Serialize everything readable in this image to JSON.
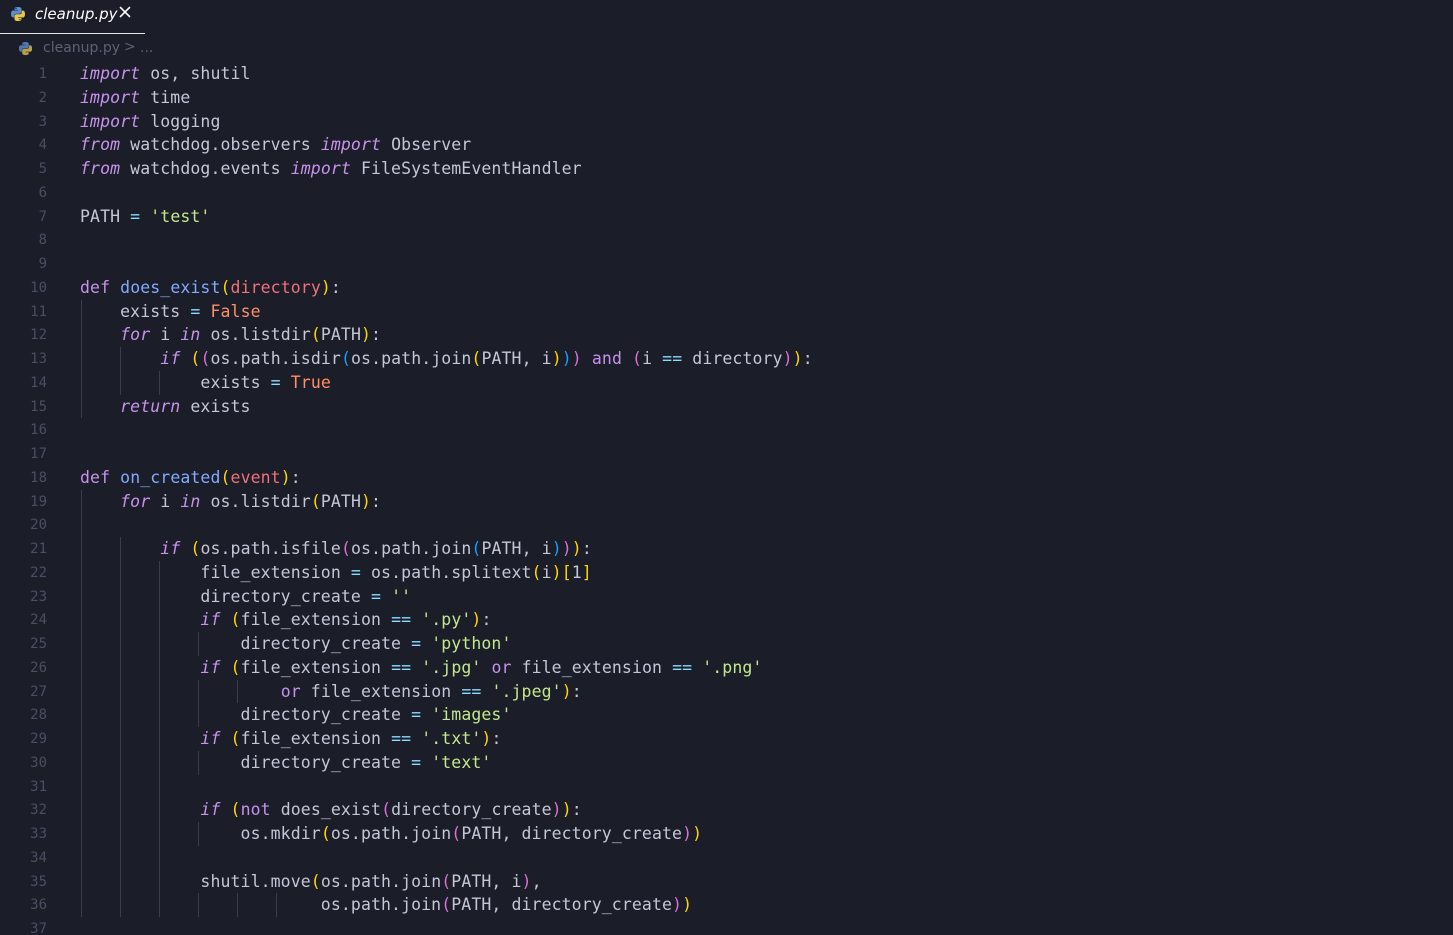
{
  "tab": {
    "title": "cleanup.py",
    "icon": "python-icon",
    "close_icon": "close-icon"
  },
  "breadcrumb": {
    "file": "cleanup.py",
    "separator": ">",
    "more": "..."
  },
  "code_lines": [
    [
      [
        "kw-i",
        "import"
      ],
      [
        "txt",
        " os, shutil"
      ]
    ],
    [
      [
        "kw-i",
        "import"
      ],
      [
        "txt",
        " time"
      ]
    ],
    [
      [
        "kw-i",
        "import"
      ],
      [
        "txt",
        " logging"
      ]
    ],
    [
      [
        "kw-i",
        "from"
      ],
      [
        "txt",
        " watchdog.observers "
      ],
      [
        "kw-i",
        "import"
      ],
      [
        "txt",
        " Observer"
      ]
    ],
    [
      [
        "kw-i",
        "from"
      ],
      [
        "txt",
        " watchdog.events "
      ],
      [
        "kw-i",
        "import"
      ],
      [
        "txt",
        " FileSystemEventHandler"
      ]
    ],
    [],
    [
      [
        "txt",
        "PATH "
      ],
      [
        "op",
        "="
      ],
      [
        "txt",
        " "
      ],
      [
        "str",
        "'test'"
      ]
    ],
    [],
    [],
    [
      [
        "kw",
        "def"
      ],
      [
        "txt",
        " "
      ],
      [
        "fn",
        "does_exist"
      ],
      [
        "p1",
        "("
      ],
      [
        "par",
        "directory"
      ],
      [
        "p1",
        ")"
      ],
      [
        "txt",
        ":"
      ]
    ],
    [
      [
        "txt",
        "    exists "
      ],
      [
        "op",
        "="
      ],
      [
        "txt",
        " "
      ],
      [
        "con",
        "False"
      ]
    ],
    [
      [
        "txt",
        "    "
      ],
      [
        "kw-i",
        "for"
      ],
      [
        "txt",
        " i "
      ],
      [
        "kw-i",
        "in"
      ],
      [
        "txt",
        " os.listdir"
      ],
      [
        "p1",
        "("
      ],
      [
        "txt",
        "PATH"
      ],
      [
        "p1",
        ")"
      ],
      [
        "txt",
        ":"
      ]
    ],
    [
      [
        "txt",
        "        "
      ],
      [
        "kw-i",
        "if"
      ],
      [
        "txt",
        " "
      ],
      [
        "p1",
        "("
      ],
      [
        "p2",
        "("
      ],
      [
        "txt",
        "os.path.isdir"
      ],
      [
        "p3",
        "("
      ],
      [
        "txt",
        "os.path.join"
      ],
      [
        "p1",
        "("
      ],
      [
        "txt",
        "PATH, i"
      ],
      [
        "p1",
        ")"
      ],
      [
        "p3",
        ")"
      ],
      [
        "p2",
        ")"
      ],
      [
        "txt",
        " "
      ],
      [
        "kw",
        "and"
      ],
      [
        "txt",
        " "
      ],
      [
        "p2",
        "("
      ],
      [
        "txt",
        "i "
      ],
      [
        "op",
        "=="
      ],
      [
        "txt",
        " directory"
      ],
      [
        "p2",
        ")"
      ],
      [
        "p1",
        ")"
      ],
      [
        "txt",
        ":"
      ]
    ],
    [
      [
        "txt",
        "            exists "
      ],
      [
        "op",
        "="
      ],
      [
        "txt",
        " "
      ],
      [
        "con",
        "True"
      ]
    ],
    [
      [
        "txt",
        "    "
      ],
      [
        "kw-i",
        "return"
      ],
      [
        "txt",
        " exists"
      ]
    ],
    [],
    [],
    [
      [
        "kw",
        "def"
      ],
      [
        "txt",
        " "
      ],
      [
        "fn",
        "on_created"
      ],
      [
        "p1",
        "("
      ],
      [
        "par",
        "event"
      ],
      [
        "p1",
        ")"
      ],
      [
        "txt",
        ":"
      ]
    ],
    [
      [
        "txt",
        "    "
      ],
      [
        "kw-i",
        "for"
      ],
      [
        "txt",
        " i "
      ],
      [
        "kw-i",
        "in"
      ],
      [
        "txt",
        " os.listdir"
      ],
      [
        "p1",
        "("
      ],
      [
        "txt",
        "PATH"
      ],
      [
        "p1",
        ")"
      ],
      [
        "txt",
        ":"
      ]
    ],
    [],
    [
      [
        "txt",
        "        "
      ],
      [
        "kw-i",
        "if"
      ],
      [
        "txt",
        " "
      ],
      [
        "p1",
        "("
      ],
      [
        "txt",
        "os.path.isfile"
      ],
      [
        "p2",
        "("
      ],
      [
        "txt",
        "os.path.join"
      ],
      [
        "p3",
        "("
      ],
      [
        "txt",
        "PATH, i"
      ],
      [
        "p3",
        ")"
      ],
      [
        "p2",
        ")"
      ],
      [
        "p1",
        ")"
      ],
      [
        "txt",
        ":"
      ]
    ],
    [
      [
        "txt",
        "            file_extension "
      ],
      [
        "op",
        "="
      ],
      [
        "txt",
        " os.path.splitext"
      ],
      [
        "p1",
        "("
      ],
      [
        "txt",
        "i"
      ],
      [
        "p1",
        ")"
      ],
      [
        "p1",
        "["
      ],
      [
        "txt",
        "1"
      ],
      [
        "p1",
        "]"
      ]
    ],
    [
      [
        "txt",
        "            directory_create "
      ],
      [
        "op",
        "="
      ],
      [
        "txt",
        " "
      ],
      [
        "str",
        "''"
      ]
    ],
    [
      [
        "txt",
        "            "
      ],
      [
        "kw-i",
        "if"
      ],
      [
        "txt",
        " "
      ],
      [
        "p1",
        "("
      ],
      [
        "txt",
        "file_extension "
      ],
      [
        "op",
        "=="
      ],
      [
        "txt",
        " "
      ],
      [
        "str",
        "'.py'"
      ],
      [
        "p1",
        ")"
      ],
      [
        "txt",
        ":"
      ]
    ],
    [
      [
        "txt",
        "                directory_create "
      ],
      [
        "op",
        "="
      ],
      [
        "txt",
        " "
      ],
      [
        "str",
        "'python'"
      ]
    ],
    [
      [
        "txt",
        "            "
      ],
      [
        "kw-i",
        "if"
      ],
      [
        "txt",
        " "
      ],
      [
        "p1",
        "("
      ],
      [
        "txt",
        "file_extension "
      ],
      [
        "op",
        "=="
      ],
      [
        "txt",
        " "
      ],
      [
        "str",
        "'.jpg'"
      ],
      [
        "txt",
        " "
      ],
      [
        "kw",
        "or"
      ],
      [
        "txt",
        " file_extension "
      ],
      [
        "op",
        "=="
      ],
      [
        "txt",
        " "
      ],
      [
        "str",
        "'.png'"
      ]
    ],
    [
      [
        "txt",
        "                    "
      ],
      [
        "kw",
        "or"
      ],
      [
        "txt",
        " file_extension "
      ],
      [
        "op",
        "=="
      ],
      [
        "txt",
        " "
      ],
      [
        "str",
        "'.jpeg'"
      ],
      [
        "p1",
        ")"
      ],
      [
        "txt",
        ":"
      ]
    ],
    [
      [
        "txt",
        "                directory_create "
      ],
      [
        "op",
        "="
      ],
      [
        "txt",
        " "
      ],
      [
        "str",
        "'images'"
      ]
    ],
    [
      [
        "txt",
        "            "
      ],
      [
        "kw-i",
        "if"
      ],
      [
        "txt",
        " "
      ],
      [
        "p1",
        "("
      ],
      [
        "txt",
        "file_extension "
      ],
      [
        "op",
        "=="
      ],
      [
        "txt",
        " "
      ],
      [
        "str",
        "'.txt'"
      ],
      [
        "p1",
        ")"
      ],
      [
        "txt",
        ":"
      ]
    ],
    [
      [
        "txt",
        "                directory_create "
      ],
      [
        "op",
        "="
      ],
      [
        "txt",
        " "
      ],
      [
        "str",
        "'text'"
      ]
    ],
    [],
    [
      [
        "txt",
        "            "
      ],
      [
        "kw-i",
        "if"
      ],
      [
        "txt",
        " "
      ],
      [
        "p1",
        "("
      ],
      [
        "kw",
        "not"
      ],
      [
        "txt",
        " does_exist"
      ],
      [
        "p2",
        "("
      ],
      [
        "txt",
        "directory_create"
      ],
      [
        "p2",
        ")"
      ],
      [
        "p1",
        ")"
      ],
      [
        "txt",
        ":"
      ]
    ],
    [
      [
        "txt",
        "                os.mkdir"
      ],
      [
        "p1",
        "("
      ],
      [
        "txt",
        "os.path.join"
      ],
      [
        "p2",
        "("
      ],
      [
        "txt",
        "PATH, directory_create"
      ],
      [
        "p2",
        ")"
      ],
      [
        "p1",
        ")"
      ]
    ],
    [],
    [
      [
        "txt",
        "            shutil.move"
      ],
      [
        "p1",
        "("
      ],
      [
        "txt",
        "os.path.join"
      ],
      [
        "p2",
        "("
      ],
      [
        "txt",
        "PATH, i"
      ],
      [
        "p2",
        ")"
      ],
      [
        "txt",
        ","
      ]
    ],
    [
      [
        "txt",
        "                        os.path.join"
      ],
      [
        "p2",
        "("
      ],
      [
        "txt",
        "PATH, directory_create"
      ],
      [
        "p2",
        ")"
      ],
      [
        "p1",
        ")"
      ]
    ],
    []
  ],
  "line_numbers": [
    "1",
    "2",
    "3",
    "4",
    "5",
    "6",
    "7",
    "8",
    "9",
    "10",
    "11",
    "12",
    "13",
    "14",
    "15",
    "16",
    "17",
    "18",
    "19",
    "20",
    "21",
    "22",
    "23",
    "24",
    "25",
    "26",
    "27",
    "28",
    "29",
    "30",
    "31",
    "32",
    "33",
    "34",
    "35",
    "36",
    "37"
  ],
  "colors": {
    "background": "#1b1d29",
    "keyword": "#c792ea",
    "function": "#82aaff",
    "parameter": "#f07178",
    "string": "#c3e88d",
    "constant": "#ff9066",
    "bracket_level1": "#ffd700",
    "bracket_level2": "#da70d6",
    "bracket_level3": "#179fff",
    "line_number": "#4a4e62"
  }
}
